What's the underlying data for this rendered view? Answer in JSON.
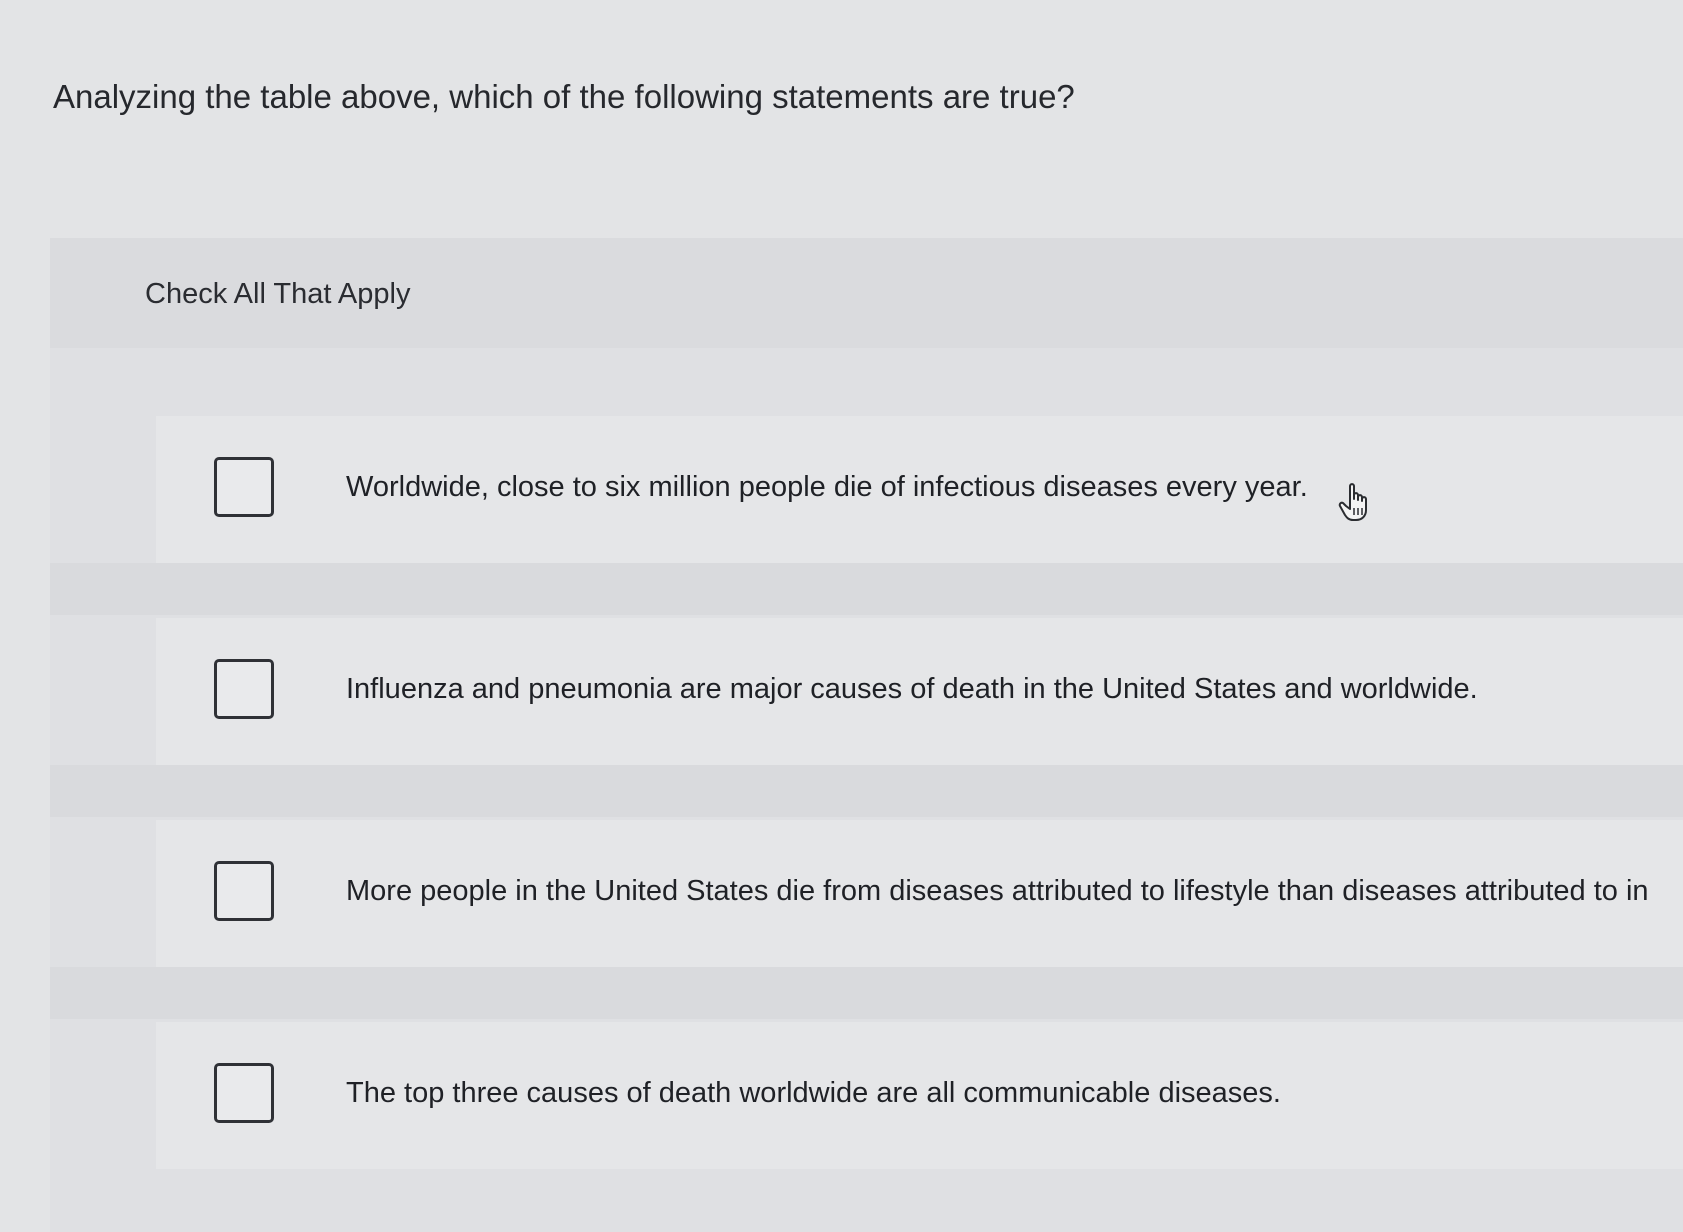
{
  "question": {
    "text": "Analyzing the table above, which of the following statements are true?"
  },
  "panel": {
    "instruction": "Check All That Apply",
    "options": [
      {
        "label": "Worldwide, close to six million people die of infectious diseases every year.",
        "checked": false
      },
      {
        "label": "Influenza and pneumonia are major causes of death in the United States and worldwide.",
        "checked": false
      },
      {
        "label": "More people in the United States die from diseases attributed to lifestyle than diseases attributed to in",
        "checked": false
      },
      {
        "label": "The top three causes of death worldwide are all communicable diseases.",
        "checked": false
      }
    ]
  },
  "cursor": {
    "icon": "hand-pointer-icon"
  }
}
